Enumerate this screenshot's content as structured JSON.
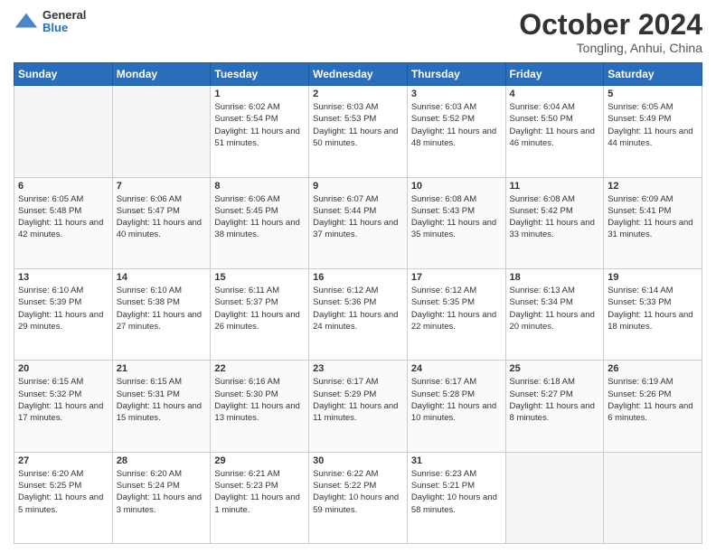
{
  "header": {
    "logo_general": "General",
    "logo_blue": "Blue",
    "month_title": "October 2024",
    "subtitle": "Tongling, Anhui, China"
  },
  "weekdays": [
    "Sunday",
    "Monday",
    "Tuesday",
    "Wednesday",
    "Thursday",
    "Friday",
    "Saturday"
  ],
  "weeks": [
    [
      {
        "day": null
      },
      {
        "day": null
      },
      {
        "day": "1",
        "sunrise": "Sunrise: 6:02 AM",
        "sunset": "Sunset: 5:54 PM",
        "daylight": "Daylight: 11 hours and 51 minutes."
      },
      {
        "day": "2",
        "sunrise": "Sunrise: 6:03 AM",
        "sunset": "Sunset: 5:53 PM",
        "daylight": "Daylight: 11 hours and 50 minutes."
      },
      {
        "day": "3",
        "sunrise": "Sunrise: 6:03 AM",
        "sunset": "Sunset: 5:52 PM",
        "daylight": "Daylight: 11 hours and 48 minutes."
      },
      {
        "day": "4",
        "sunrise": "Sunrise: 6:04 AM",
        "sunset": "Sunset: 5:50 PM",
        "daylight": "Daylight: 11 hours and 46 minutes."
      },
      {
        "day": "5",
        "sunrise": "Sunrise: 6:05 AM",
        "sunset": "Sunset: 5:49 PM",
        "daylight": "Daylight: 11 hours and 44 minutes."
      }
    ],
    [
      {
        "day": "6",
        "sunrise": "Sunrise: 6:05 AM",
        "sunset": "Sunset: 5:48 PM",
        "daylight": "Daylight: 11 hours and 42 minutes."
      },
      {
        "day": "7",
        "sunrise": "Sunrise: 6:06 AM",
        "sunset": "Sunset: 5:47 PM",
        "daylight": "Daylight: 11 hours and 40 minutes."
      },
      {
        "day": "8",
        "sunrise": "Sunrise: 6:06 AM",
        "sunset": "Sunset: 5:45 PM",
        "daylight": "Daylight: 11 hours and 38 minutes."
      },
      {
        "day": "9",
        "sunrise": "Sunrise: 6:07 AM",
        "sunset": "Sunset: 5:44 PM",
        "daylight": "Daylight: 11 hours and 37 minutes."
      },
      {
        "day": "10",
        "sunrise": "Sunrise: 6:08 AM",
        "sunset": "Sunset: 5:43 PM",
        "daylight": "Daylight: 11 hours and 35 minutes."
      },
      {
        "day": "11",
        "sunrise": "Sunrise: 6:08 AM",
        "sunset": "Sunset: 5:42 PM",
        "daylight": "Daylight: 11 hours and 33 minutes."
      },
      {
        "day": "12",
        "sunrise": "Sunrise: 6:09 AM",
        "sunset": "Sunset: 5:41 PM",
        "daylight": "Daylight: 11 hours and 31 minutes."
      }
    ],
    [
      {
        "day": "13",
        "sunrise": "Sunrise: 6:10 AM",
        "sunset": "Sunset: 5:39 PM",
        "daylight": "Daylight: 11 hours and 29 minutes."
      },
      {
        "day": "14",
        "sunrise": "Sunrise: 6:10 AM",
        "sunset": "Sunset: 5:38 PM",
        "daylight": "Daylight: 11 hours and 27 minutes."
      },
      {
        "day": "15",
        "sunrise": "Sunrise: 6:11 AM",
        "sunset": "Sunset: 5:37 PM",
        "daylight": "Daylight: 11 hours and 26 minutes."
      },
      {
        "day": "16",
        "sunrise": "Sunrise: 6:12 AM",
        "sunset": "Sunset: 5:36 PM",
        "daylight": "Daylight: 11 hours and 24 minutes."
      },
      {
        "day": "17",
        "sunrise": "Sunrise: 6:12 AM",
        "sunset": "Sunset: 5:35 PM",
        "daylight": "Daylight: 11 hours and 22 minutes."
      },
      {
        "day": "18",
        "sunrise": "Sunrise: 6:13 AM",
        "sunset": "Sunset: 5:34 PM",
        "daylight": "Daylight: 11 hours and 20 minutes."
      },
      {
        "day": "19",
        "sunrise": "Sunrise: 6:14 AM",
        "sunset": "Sunset: 5:33 PM",
        "daylight": "Daylight: 11 hours and 18 minutes."
      }
    ],
    [
      {
        "day": "20",
        "sunrise": "Sunrise: 6:15 AM",
        "sunset": "Sunset: 5:32 PM",
        "daylight": "Daylight: 11 hours and 17 minutes."
      },
      {
        "day": "21",
        "sunrise": "Sunrise: 6:15 AM",
        "sunset": "Sunset: 5:31 PM",
        "daylight": "Daylight: 11 hours and 15 minutes."
      },
      {
        "day": "22",
        "sunrise": "Sunrise: 6:16 AM",
        "sunset": "Sunset: 5:30 PM",
        "daylight": "Daylight: 11 hours and 13 minutes."
      },
      {
        "day": "23",
        "sunrise": "Sunrise: 6:17 AM",
        "sunset": "Sunset: 5:29 PM",
        "daylight": "Daylight: 11 hours and 11 minutes."
      },
      {
        "day": "24",
        "sunrise": "Sunrise: 6:17 AM",
        "sunset": "Sunset: 5:28 PM",
        "daylight": "Daylight: 11 hours and 10 minutes."
      },
      {
        "day": "25",
        "sunrise": "Sunrise: 6:18 AM",
        "sunset": "Sunset: 5:27 PM",
        "daylight": "Daylight: 11 hours and 8 minutes."
      },
      {
        "day": "26",
        "sunrise": "Sunrise: 6:19 AM",
        "sunset": "Sunset: 5:26 PM",
        "daylight": "Daylight: 11 hours and 6 minutes."
      }
    ],
    [
      {
        "day": "27",
        "sunrise": "Sunrise: 6:20 AM",
        "sunset": "Sunset: 5:25 PM",
        "daylight": "Daylight: 11 hours and 5 minutes."
      },
      {
        "day": "28",
        "sunrise": "Sunrise: 6:20 AM",
        "sunset": "Sunset: 5:24 PM",
        "daylight": "Daylight: 11 hours and 3 minutes."
      },
      {
        "day": "29",
        "sunrise": "Sunrise: 6:21 AM",
        "sunset": "Sunset: 5:23 PM",
        "daylight": "Daylight: 11 hours and 1 minute."
      },
      {
        "day": "30",
        "sunrise": "Sunrise: 6:22 AM",
        "sunset": "Sunset: 5:22 PM",
        "daylight": "Daylight: 10 hours and 59 minutes."
      },
      {
        "day": "31",
        "sunrise": "Sunrise: 6:23 AM",
        "sunset": "Sunset: 5:21 PM",
        "daylight": "Daylight: 10 hours and 58 minutes."
      },
      {
        "day": null
      },
      {
        "day": null
      }
    ]
  ]
}
